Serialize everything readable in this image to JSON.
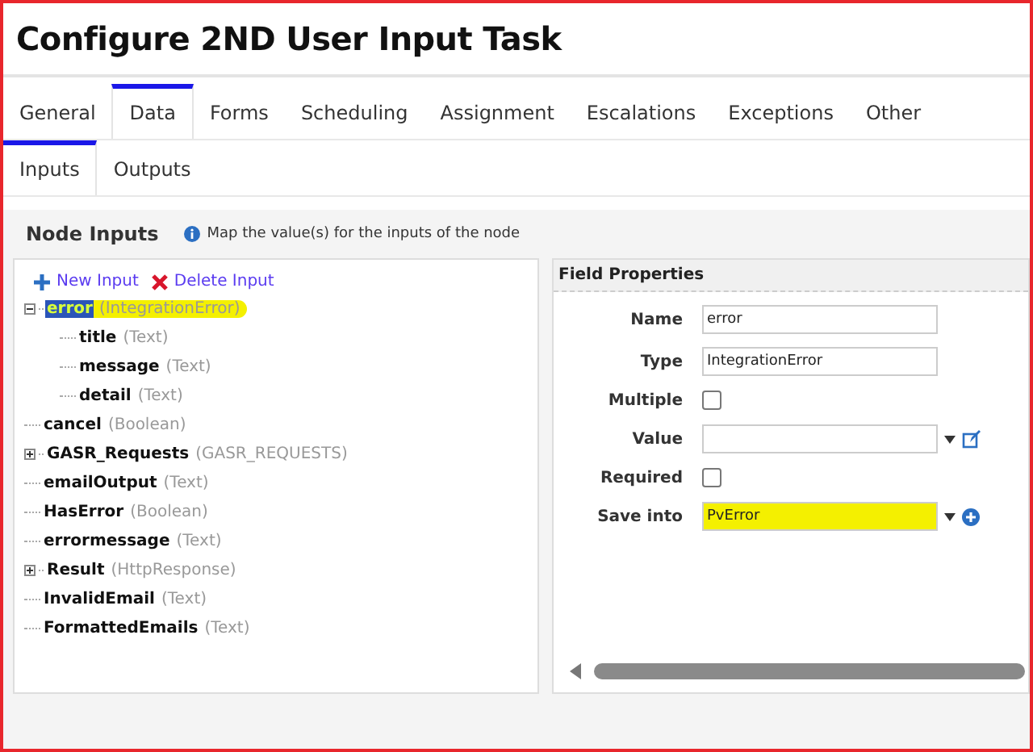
{
  "window": {
    "title": "Configure 2ND User Input Task"
  },
  "tabs": [
    {
      "label": "General",
      "selected": false
    },
    {
      "label": "Data",
      "selected": true
    },
    {
      "label": "Forms",
      "selected": false
    },
    {
      "label": "Scheduling",
      "selected": false
    },
    {
      "label": "Assignment",
      "selected": false
    },
    {
      "label": "Escalations",
      "selected": false
    },
    {
      "label": "Exceptions",
      "selected": false
    },
    {
      "label": "Other",
      "selected": false
    }
  ],
  "subtabs": [
    {
      "label": "Inputs",
      "selected": true
    },
    {
      "label": "Outputs",
      "selected": false
    }
  ],
  "section": {
    "title": "Node Inputs",
    "info": "Map the value(s) for the inputs of the node"
  },
  "toolbar": {
    "new": "New Input",
    "delete": "Delete Input"
  },
  "tree": [
    {
      "kind": "folder",
      "name": "error",
      "type": "(IntegrationError)",
      "expanded": true,
      "selected": true,
      "highlighted": true,
      "children": [
        {
          "kind": "leaf",
          "name": "title",
          "type": "(Text)",
          "selected": false,
          "highlighted": false
        },
        {
          "kind": "leaf",
          "name": "message",
          "type": "(Text)",
          "selected": false,
          "highlighted": false
        },
        {
          "kind": "leaf",
          "name": "detail",
          "type": "(Text)",
          "selected": false,
          "highlighted": false
        }
      ]
    },
    {
      "kind": "leaf",
      "name": "cancel",
      "type": "(Boolean)",
      "selected": false,
      "highlighted": false
    },
    {
      "kind": "folder",
      "name": "GASR_Requests",
      "type": "(GASR_REQUESTS)",
      "expanded": false,
      "selected": false,
      "highlighted": false
    },
    {
      "kind": "leaf",
      "name": "emailOutput",
      "type": "(Text)",
      "selected": false,
      "highlighted": false
    },
    {
      "kind": "leaf",
      "name": "HasError",
      "type": "(Boolean)",
      "selected": false,
      "highlighted": false
    },
    {
      "kind": "leaf",
      "name": "errormessage",
      "type": "(Text)",
      "selected": false,
      "highlighted": false
    },
    {
      "kind": "folder",
      "name": "Result",
      "type": "(HttpResponse)",
      "expanded": false,
      "selected": false,
      "highlighted": false
    },
    {
      "kind": "leaf",
      "name": "InvalidEmail",
      "type": "(Text)",
      "selected": false,
      "highlighted": false
    },
    {
      "kind": "leaf",
      "name": "FormattedEmails",
      "type": "(Text)",
      "selected": false,
      "highlighted": false
    }
  ],
  "properties": {
    "title": "Field Properties",
    "fields": [
      {
        "kind": "text",
        "label": "Name",
        "value": "error",
        "highlighted": false
      },
      {
        "kind": "text",
        "label": "Type",
        "value": "IntegrationError",
        "highlighted": false
      },
      {
        "kind": "checkbox",
        "label": "Multiple",
        "checked": false
      },
      {
        "kind": "combo-edit",
        "label": "Value",
        "highlighted": false
      },
      {
        "kind": "checkbox",
        "label": "Required",
        "checked": false
      },
      {
        "kind": "combo-add",
        "label": "Save into",
        "value": "PvError",
        "highlighted": true
      }
    ]
  }
}
